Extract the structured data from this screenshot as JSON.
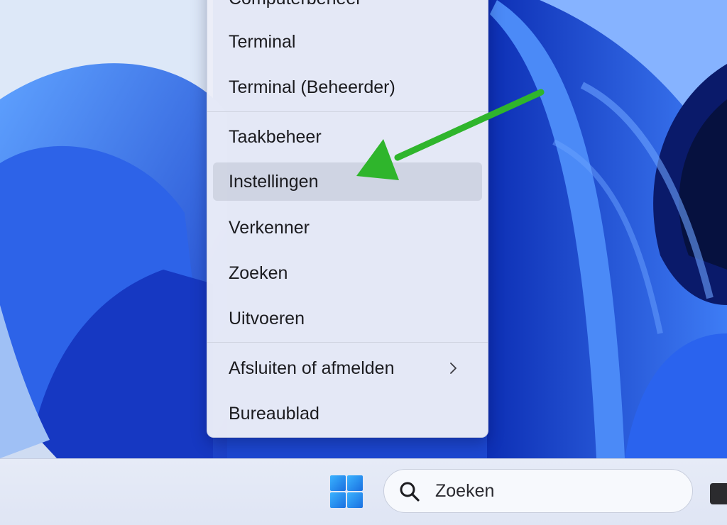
{
  "context_menu": {
    "items": [
      {
        "label": "Computerbeheer"
      },
      {
        "label": "Terminal"
      },
      {
        "label": "Terminal (Beheerder)"
      },
      {
        "label": "Taakbeheer"
      },
      {
        "label": "Instellingen"
      },
      {
        "label": "Verkenner"
      },
      {
        "label": "Zoeken"
      },
      {
        "label": "Uitvoeren"
      },
      {
        "label": "Afsluiten of afmelden",
        "submenu_icon": "chevron-right-icon"
      },
      {
        "label": "Bureaublad"
      }
    ],
    "highlighted_item": "Instellingen"
  },
  "taskbar": {
    "start_icon": "windows-logo-icon",
    "search": {
      "placeholder": "Zoeken",
      "icon": "search-icon"
    }
  },
  "colors": {
    "wallpaper_blue": "#1d4fd6",
    "menu_background": "#eceef8",
    "highlight": "#c8cddc",
    "annotation_arrow": "#2fb52c",
    "start_icon_blue": "#2a8cf0"
  },
  "annotation": {
    "type": "arrow",
    "points_to": "Instellingen"
  }
}
